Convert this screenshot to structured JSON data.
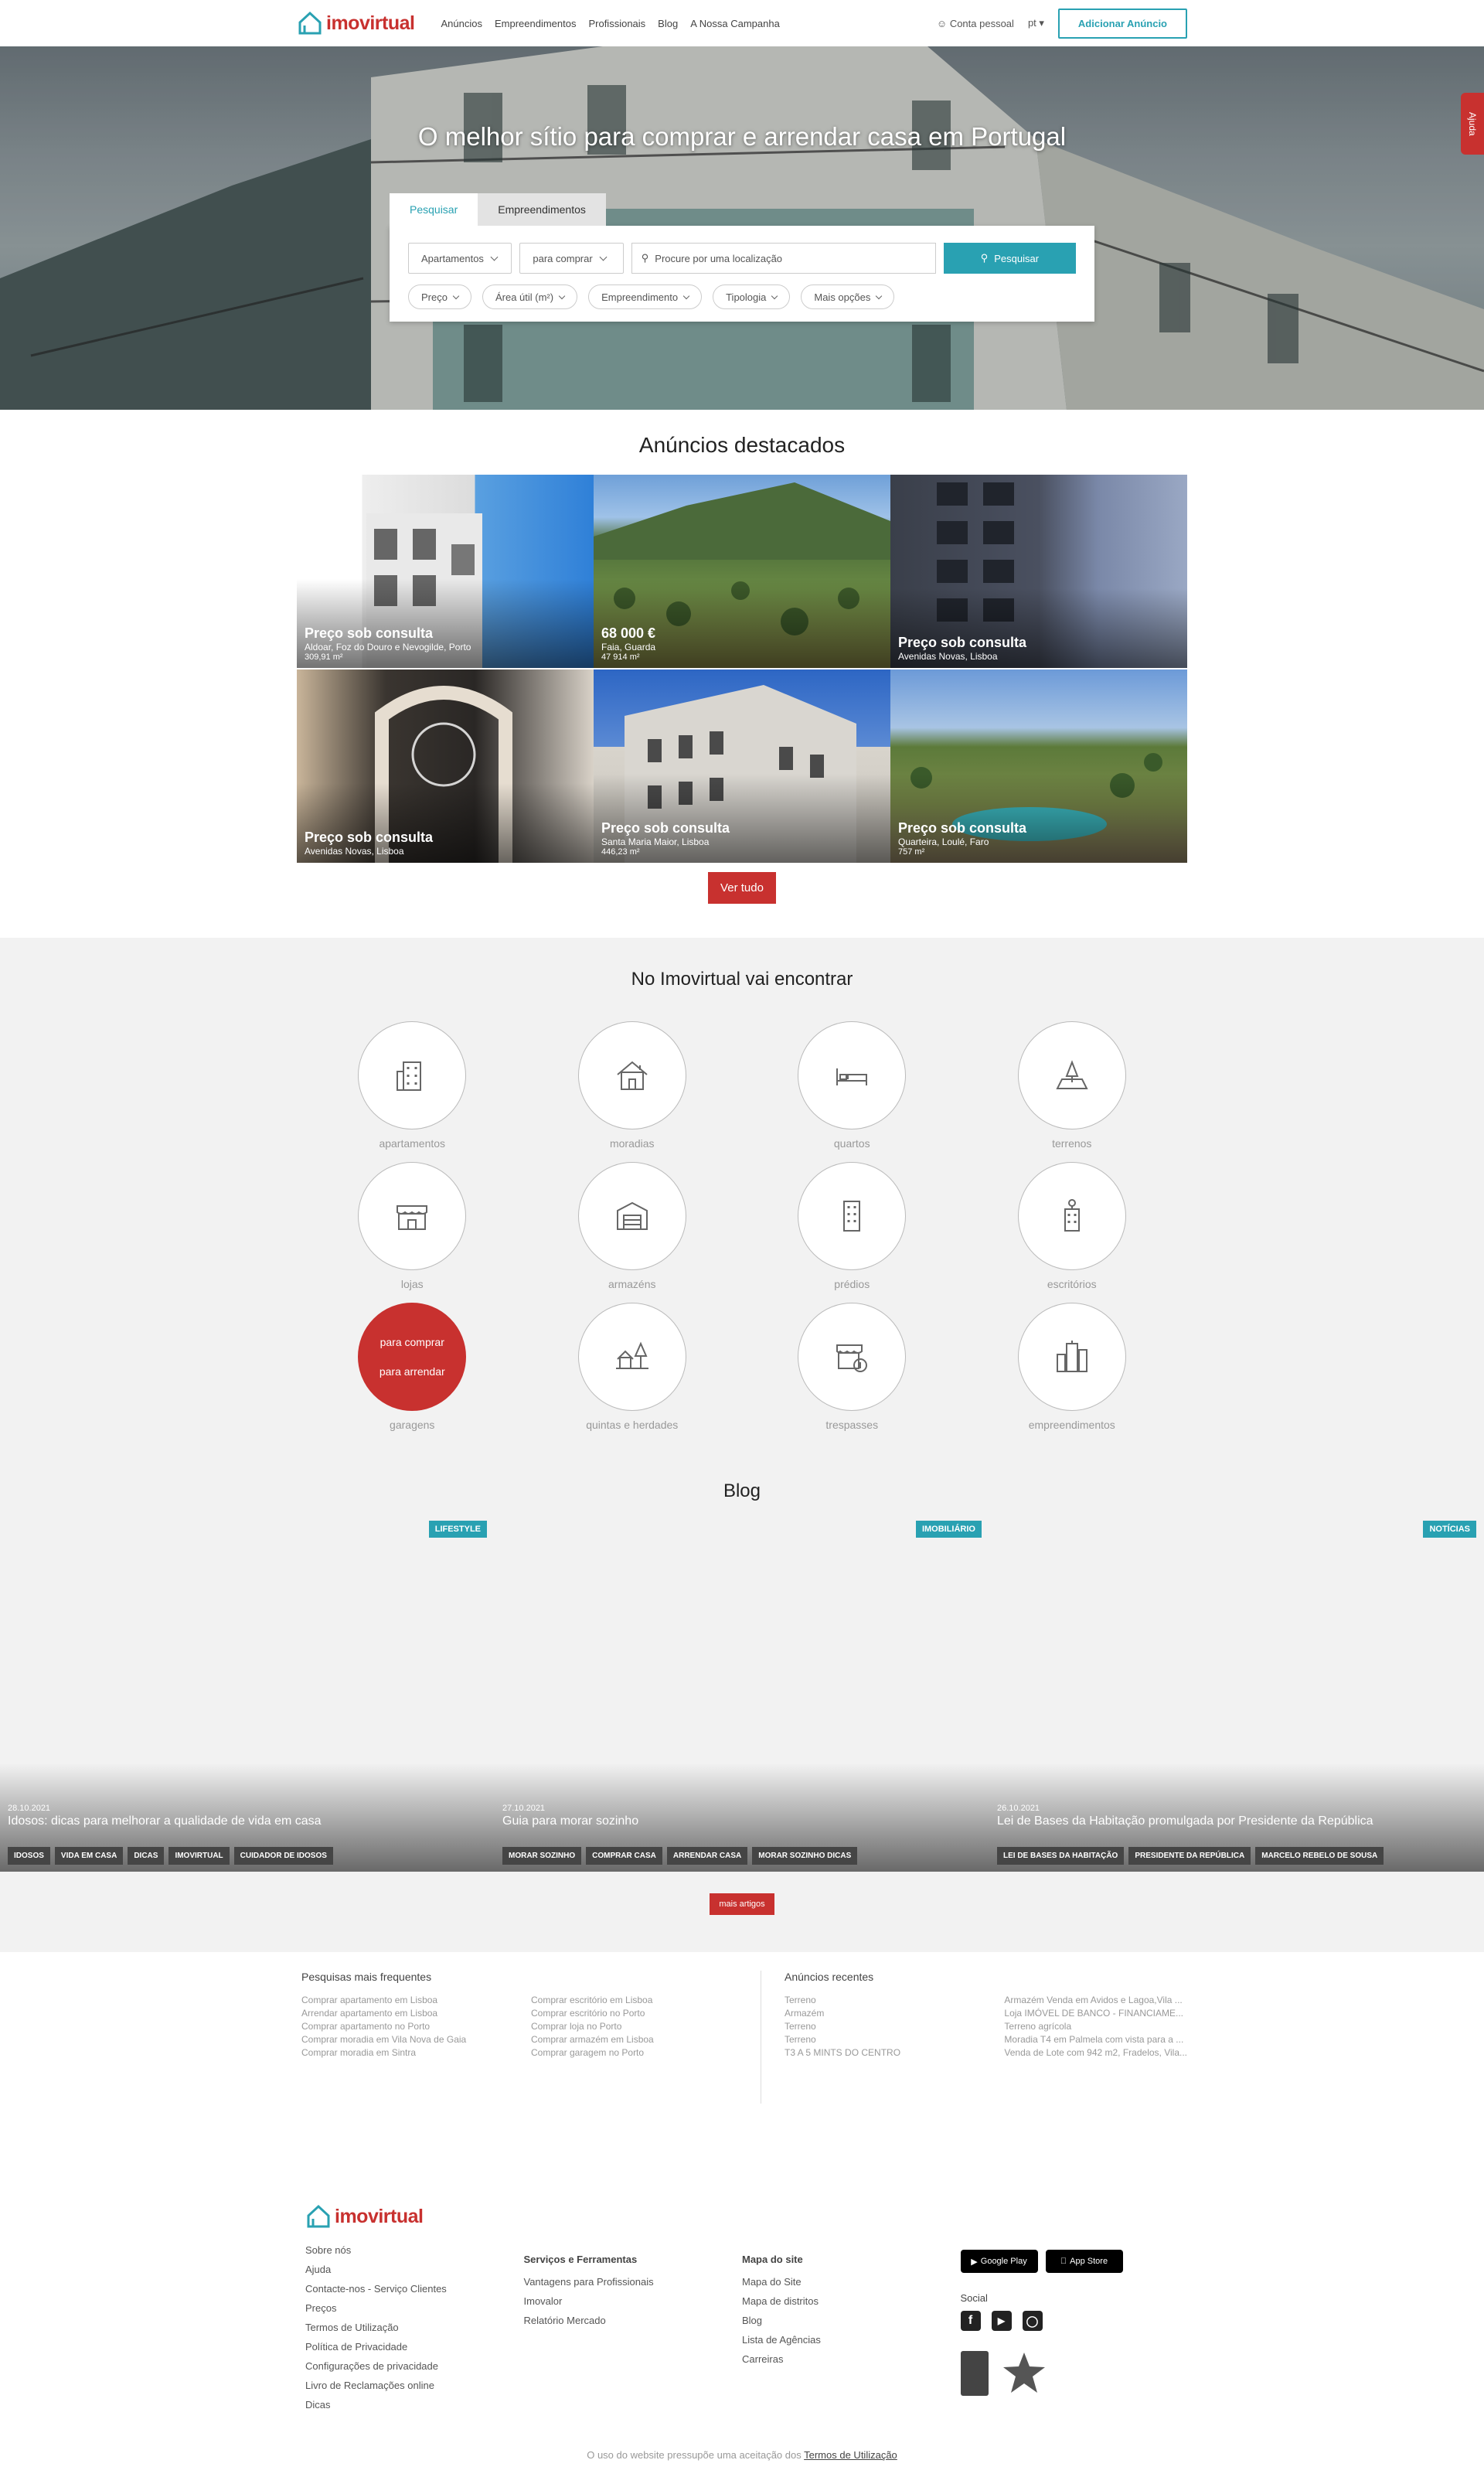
{
  "header": {
    "logo_text": "imovirtual",
    "nav": [
      "Anúncios",
      "Empreendimentos",
      "Profissionais",
      "Blog",
      "A Nossa Campanha"
    ],
    "account": "Conta pessoal",
    "lang": "pt",
    "add_button": "Adicionar Anúncio",
    "brand_color": "#c8312f",
    "accent_color": "#29a1b2"
  },
  "hero": {
    "title": "O melhor sítio para comprar e arrendar casa em Portugal",
    "help": "Ajuda",
    "tabs": [
      "Pesquisar",
      "Empreendimentos"
    ],
    "type_select": "Apartamentos",
    "deal_select": "para comprar",
    "location_placeholder": "Procure por uma localização",
    "search_button": "Pesquisar",
    "filters": [
      "Preço",
      "Área útil (m²)",
      "Empreendimento",
      "Tipologia",
      "Mais opções"
    ]
  },
  "featured": {
    "title": "Anúncios destacados",
    "cards": [
      {
        "price": "Preço sob consulta",
        "location": "Aldoar, Foz do Douro e Nevogilde, Porto",
        "area": "309,91 m²"
      },
      {
        "price": "68 000 €",
        "location": "Faia, Guarda",
        "area": "47 914 m²"
      },
      {
        "price": "Preço sob consulta",
        "location": "Avenidas Novas, Lisboa",
        "area": ""
      },
      {
        "price": "Preço sob consulta",
        "location": "Avenidas Novas, Lisboa",
        "area": ""
      },
      {
        "price": "Preço sob consulta",
        "location": "Santa Maria Maior, Lisboa",
        "area": "446,23 m²"
      },
      {
        "price": "Preço sob consulta",
        "location": "Quarteira, Loulé, Faro",
        "area": "757 m²"
      }
    ],
    "see_all": "Ver tudo"
  },
  "categories": {
    "title": "No Imovirtual vai encontrar",
    "items": [
      {
        "label": "apartamentos",
        "icon": "apartment-icon"
      },
      {
        "label": "moradias",
        "icon": "house-icon"
      },
      {
        "label": "quartos",
        "icon": "bed-icon"
      },
      {
        "label": "terrenos",
        "icon": "land-icon"
      },
      {
        "label": "lojas",
        "icon": "shop-icon"
      },
      {
        "label": "armazéns",
        "icon": "warehouse-icon"
      },
      {
        "label": "prédios",
        "icon": "building-icon"
      },
      {
        "label": "escritórios",
        "icon": "office-icon"
      },
      {
        "label": "garagens",
        "icon": "garage-icon"
      },
      {
        "label": "quintas e herdades",
        "icon": "farm-icon"
      },
      {
        "label": "trespasses",
        "icon": "transfer-icon"
      },
      {
        "label": "empreendimentos",
        "icon": "development-icon"
      }
    ],
    "hover_buy": "para comprar",
    "hover_rent": "para arrendar"
  },
  "blog": {
    "title": "Blog",
    "posts": [
      {
        "badge": "LIFESTYLE",
        "date": "28.10.2021",
        "title": "Idosos: dicas para melhorar a qualidade de vida em casa",
        "tags": [
          "IDOSOS",
          "VIDA EM CASA",
          "DICAS",
          "IMOVIRTUAL",
          "CUIDADOR DE IDOSOS"
        ]
      },
      {
        "badge": "IMOBILIÁRIO",
        "date": "27.10.2021",
        "title": "Guia para morar sozinho",
        "tags": [
          "MORAR SOZINHO",
          "COMPRAR CASA",
          "ARRENDAR CASA",
          "MORAR SOZINHO DICAS"
        ]
      },
      {
        "badge": "NOTÍCIAS",
        "date": "26.10.2021",
        "title": "Lei de Bases da Habitação promulgada por Presidente da República",
        "tags": [
          "LEI DE BASES DA HABITAÇÃO",
          "PRESIDENTE DA REPÚBLICA",
          "MARCELO REBELO DE SOUSA"
        ]
      }
    ],
    "more": "mais artigos"
  },
  "links": {
    "frequent_title": "Pesquisas mais frequentes",
    "frequent_a": [
      "Comprar apartamento em Lisboa",
      "Arrendar apartamento em Lisboa",
      "Comprar apartamento no Porto",
      "Comprar moradia em Vila Nova de Gaia",
      "Comprar moradia em Sintra"
    ],
    "frequent_b": [
      "Comprar escritório em Lisboa",
      "Comprar escritório no Porto",
      "Comprar loja no Porto",
      "Comprar armazém em Lisboa",
      "Comprar garagem no Porto"
    ],
    "recent_title": "Anúncios recentes",
    "recent_a": [
      "Terreno",
      "Armazém",
      "Terreno",
      "Terreno",
      "T3 A 5 MINTS DO CENTRO"
    ],
    "recent_b": [
      "Armazém Venda em Avidos e Lagoa,Vila ...",
      "Loja IMÓVEL DE BANCO - FINANCIAME...",
      "Terreno agrícola",
      "Moradia T4 em Palmela com vista para a ...",
      "Venda de Lote com 942 m2, Fradelos, Vila..."
    ]
  },
  "footer": {
    "logo_text": "imovirtual",
    "col1": [
      "Sobre nós",
      "Ajuda",
      "Contacte-nos - Serviço Clientes",
      "Preços",
      "Termos de Utilização",
      "Política de Privacidade",
      "Configurações de privacidade",
      "Livro de Reclamações online",
      "Dicas"
    ],
    "col2_title": "Serviços e Ferramentas",
    "col2": [
      "Vantagens para Profissionais",
      "Imovalor",
      "Relatório Mercado"
    ],
    "col3_title": "Mapa do site",
    "col3": [
      "Mapa do Site",
      "Mapa de distritos",
      "Blog",
      "Lista de Agências",
      "Carreiras"
    ],
    "google_play": "Google Play",
    "app_store": "App Store",
    "social_title": "Social",
    "copyright_text": "O uso do website pressupõe uma aceitação dos",
    "copyright_link": "Termos de Utilização"
  }
}
